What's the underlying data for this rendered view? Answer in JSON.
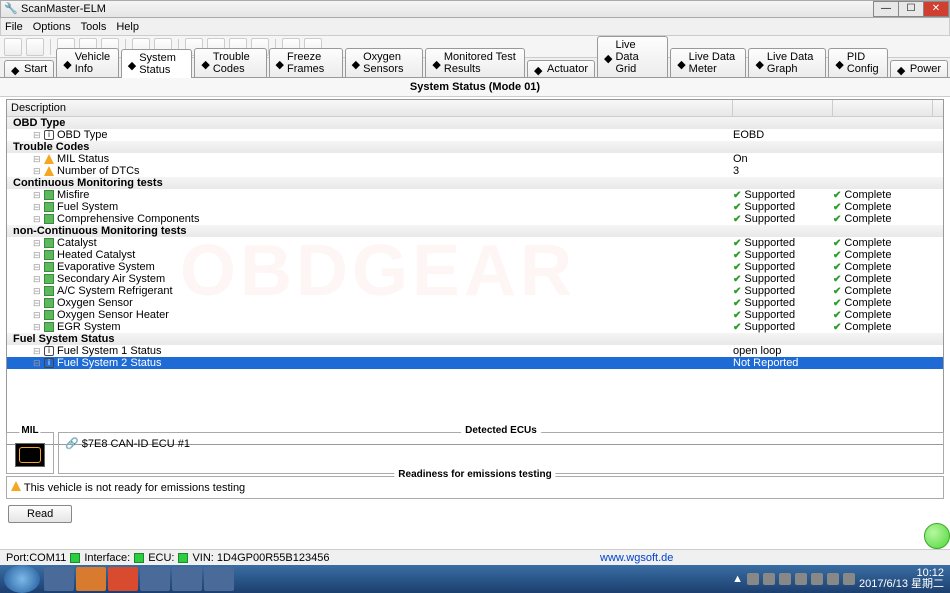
{
  "window": {
    "title": "ScanMaster-ELM"
  },
  "menu": [
    "File",
    "Options",
    "Tools",
    "Help"
  ],
  "tabs": [
    {
      "label": "Start"
    },
    {
      "label": "Vehicle Info"
    },
    {
      "label": "System Status",
      "active": true
    },
    {
      "label": "Trouble Codes"
    },
    {
      "label": "Freeze Frames"
    },
    {
      "label": "Oxygen Sensors"
    },
    {
      "label": "Monitored Test Results"
    },
    {
      "label": "Actuator"
    },
    {
      "label": "Live Data Grid"
    },
    {
      "label": "Live Data Meter"
    },
    {
      "label": "Live Data Graph"
    },
    {
      "label": "PID Config"
    },
    {
      "label": "Power"
    }
  ],
  "panel_title": "System Status (Mode 01)",
  "header_col": "Description",
  "groups": {
    "obd": {
      "title": "OBD Type",
      "rows": [
        {
          "icon": "info",
          "label": "OBD Type",
          "v1": "EOBD"
        }
      ]
    },
    "tc": {
      "title": "Trouble Codes",
      "rows": [
        {
          "icon": "warn",
          "label": "MIL Status",
          "v1": "On"
        },
        {
          "icon": "warn",
          "label": "Number of DTCs",
          "v1": "3"
        }
      ]
    },
    "cm": {
      "title": "Continuous Monitoring tests",
      "rows": [
        {
          "icon": "sq",
          "label": "Misfire",
          "v1": "Supported",
          "v2": "Complete",
          "chk": true
        },
        {
          "icon": "sq",
          "label": "Fuel System",
          "v1": "Supported",
          "v2": "Complete",
          "chk": true
        },
        {
          "icon": "sq",
          "label": "Comprehensive Components",
          "v1": "Supported",
          "v2": "Complete",
          "chk": true
        }
      ]
    },
    "ncm": {
      "title": "non-Continuous Monitoring tests",
      "rows": [
        {
          "icon": "sq",
          "label": "Catalyst",
          "v1": "Supported",
          "v2": "Complete",
          "chk": true
        },
        {
          "icon": "sq",
          "label": "Heated Catalyst",
          "v1": "Supported",
          "v2": "Complete",
          "chk": true
        },
        {
          "icon": "sq",
          "label": "Evaporative System",
          "v1": "Supported",
          "v2": "Complete",
          "chk": true
        },
        {
          "icon": "sq",
          "label": "Secondary Air System",
          "v1": "Supported",
          "v2": "Complete",
          "chk": true
        },
        {
          "icon": "sq",
          "label": "A/C System Refrigerant",
          "v1": "Supported",
          "v2": "Complete",
          "chk": true
        },
        {
          "icon": "sq",
          "label": "Oxygen Sensor",
          "v1": "Supported",
          "v2": "Complete",
          "chk": true
        },
        {
          "icon": "sq",
          "label": "Oxygen Sensor Heater",
          "v1": "Supported",
          "v2": "Complete",
          "chk": true
        },
        {
          "icon": "sq",
          "label": "EGR System",
          "v1": "Supported",
          "v2": "Complete",
          "chk": true
        }
      ]
    },
    "fss": {
      "title": "Fuel System Status",
      "rows": [
        {
          "icon": "info",
          "label": "Fuel System 1 Status",
          "v1": "open loop"
        },
        {
          "icon": "info",
          "label": "Fuel System 2 Status",
          "v1": "Not Reported",
          "sel": true
        }
      ]
    }
  },
  "mil_label": "MIL",
  "ecus": {
    "title": "Detected ECUs",
    "row": "$7E8   CAN-ID ECU #1"
  },
  "readiness": {
    "title": "Readiness for emissions testing",
    "msg": "This vehicle is not ready for emissions testing"
  },
  "read_btn": "Read",
  "status": {
    "port": "Port:",
    "portv": "COM11",
    "iface": "Interface:",
    "ecu": "ECU:",
    "vin": "VIN: 1D4GP00R55B123456",
    "url": "www.wgsoft.de"
  },
  "clock": {
    "time": "10:12",
    "date": "2017/6/13 星期二"
  }
}
